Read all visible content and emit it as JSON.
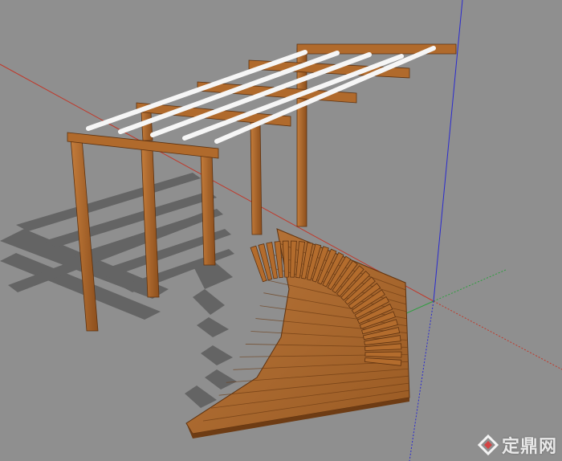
{
  "viewport": {
    "background": "#8f8f8f",
    "axis_colors": {
      "red": "#c0392b",
      "green": "#2e9e3e",
      "blue": "#2a2acf"
    }
  },
  "model": {
    "wood_color": "#b06a2c",
    "wood_dark": "#7a4216",
    "deck_color": "#a8672c",
    "purlin_color": "#f4f4f4",
    "shadow_color": "#5a5a5a"
  },
  "watermark": {
    "text": "定鼎网",
    "logo_icon": "diamond-logo-icon"
  }
}
